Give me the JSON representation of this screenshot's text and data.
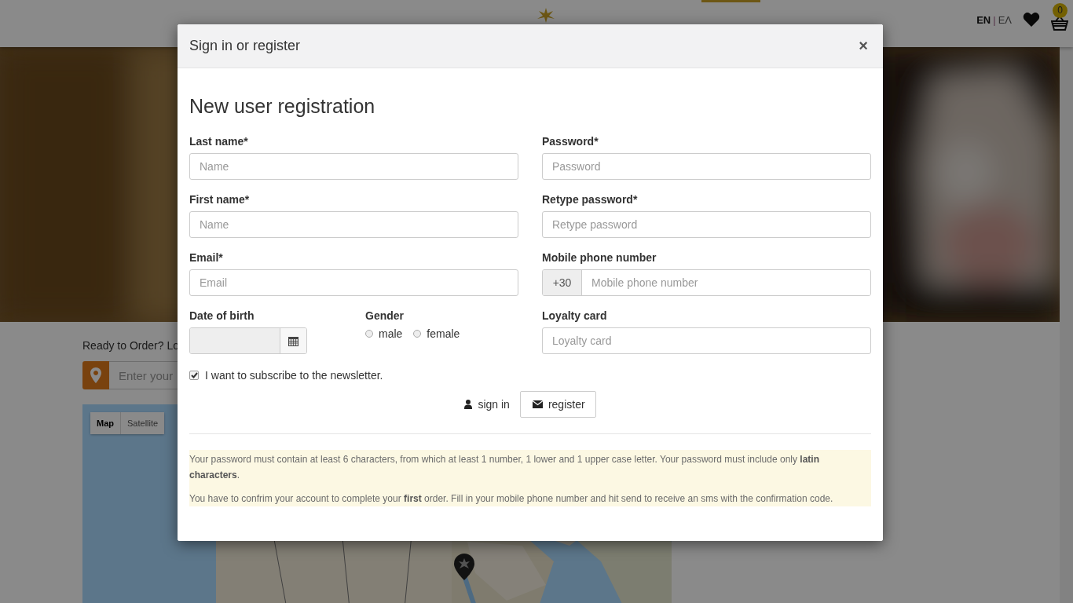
{
  "header": {
    "languages": [
      {
        "label": "EN",
        "selected": true
      },
      {
        "label": "ΕΛ",
        "selected": false
      }
    ],
    "language_separator": "|",
    "cart_count": "0"
  },
  "page": {
    "order_prompt": "Ready to Order? Lo",
    "address_placeholder": "Enter your",
    "map_types": [
      {
        "label": "Map",
        "selected": true
      },
      {
        "label": "Satellite",
        "selected": false
      }
    ]
  },
  "dialog": {
    "title": "Sign in or register",
    "close": "×",
    "heading": "New user registration",
    "left_fields": [
      {
        "kind": "text",
        "label": "Last name*",
        "placeholder": "Name"
      },
      {
        "kind": "text",
        "label": "First name*",
        "placeholder": "Name"
      },
      {
        "kind": "text",
        "label": "Email*",
        "placeholder": "Email"
      }
    ],
    "right_fields": [
      {
        "kind": "text",
        "label": "Password*",
        "placeholder": "Password"
      },
      {
        "kind": "text",
        "label": "Retype password*",
        "placeholder": "Retype password"
      },
      {
        "kind": "phone",
        "label": "Mobile phone number",
        "prefix": "+30",
        "placeholder": "Mobile phone number"
      },
      {
        "kind": "text",
        "label": "Loyalty card",
        "placeholder": "Loyalty card"
      }
    ],
    "birth_date": {
      "label": "Date of birth",
      "disabled": true
    },
    "gender": {
      "label": "Gender",
      "options": [
        {
          "label": "male",
          "selected": false
        },
        {
          "label": "female",
          "selected": false
        }
      ]
    },
    "newsletter": {
      "label": "I want to subscribe to the newsletter.",
      "checked": true
    },
    "sign_in": "sign in",
    "register": "register",
    "notes": [
      "Your password must contain at least 6 characters, from which at least 1 number, 1 lower and 1 upper case letter. Your password must include only **latin characters**.",
      "You have to confrim your account to complete your **first** order. Fill in your mobile phone number and hit send to receive an sms with the confirmation code."
    ]
  }
}
